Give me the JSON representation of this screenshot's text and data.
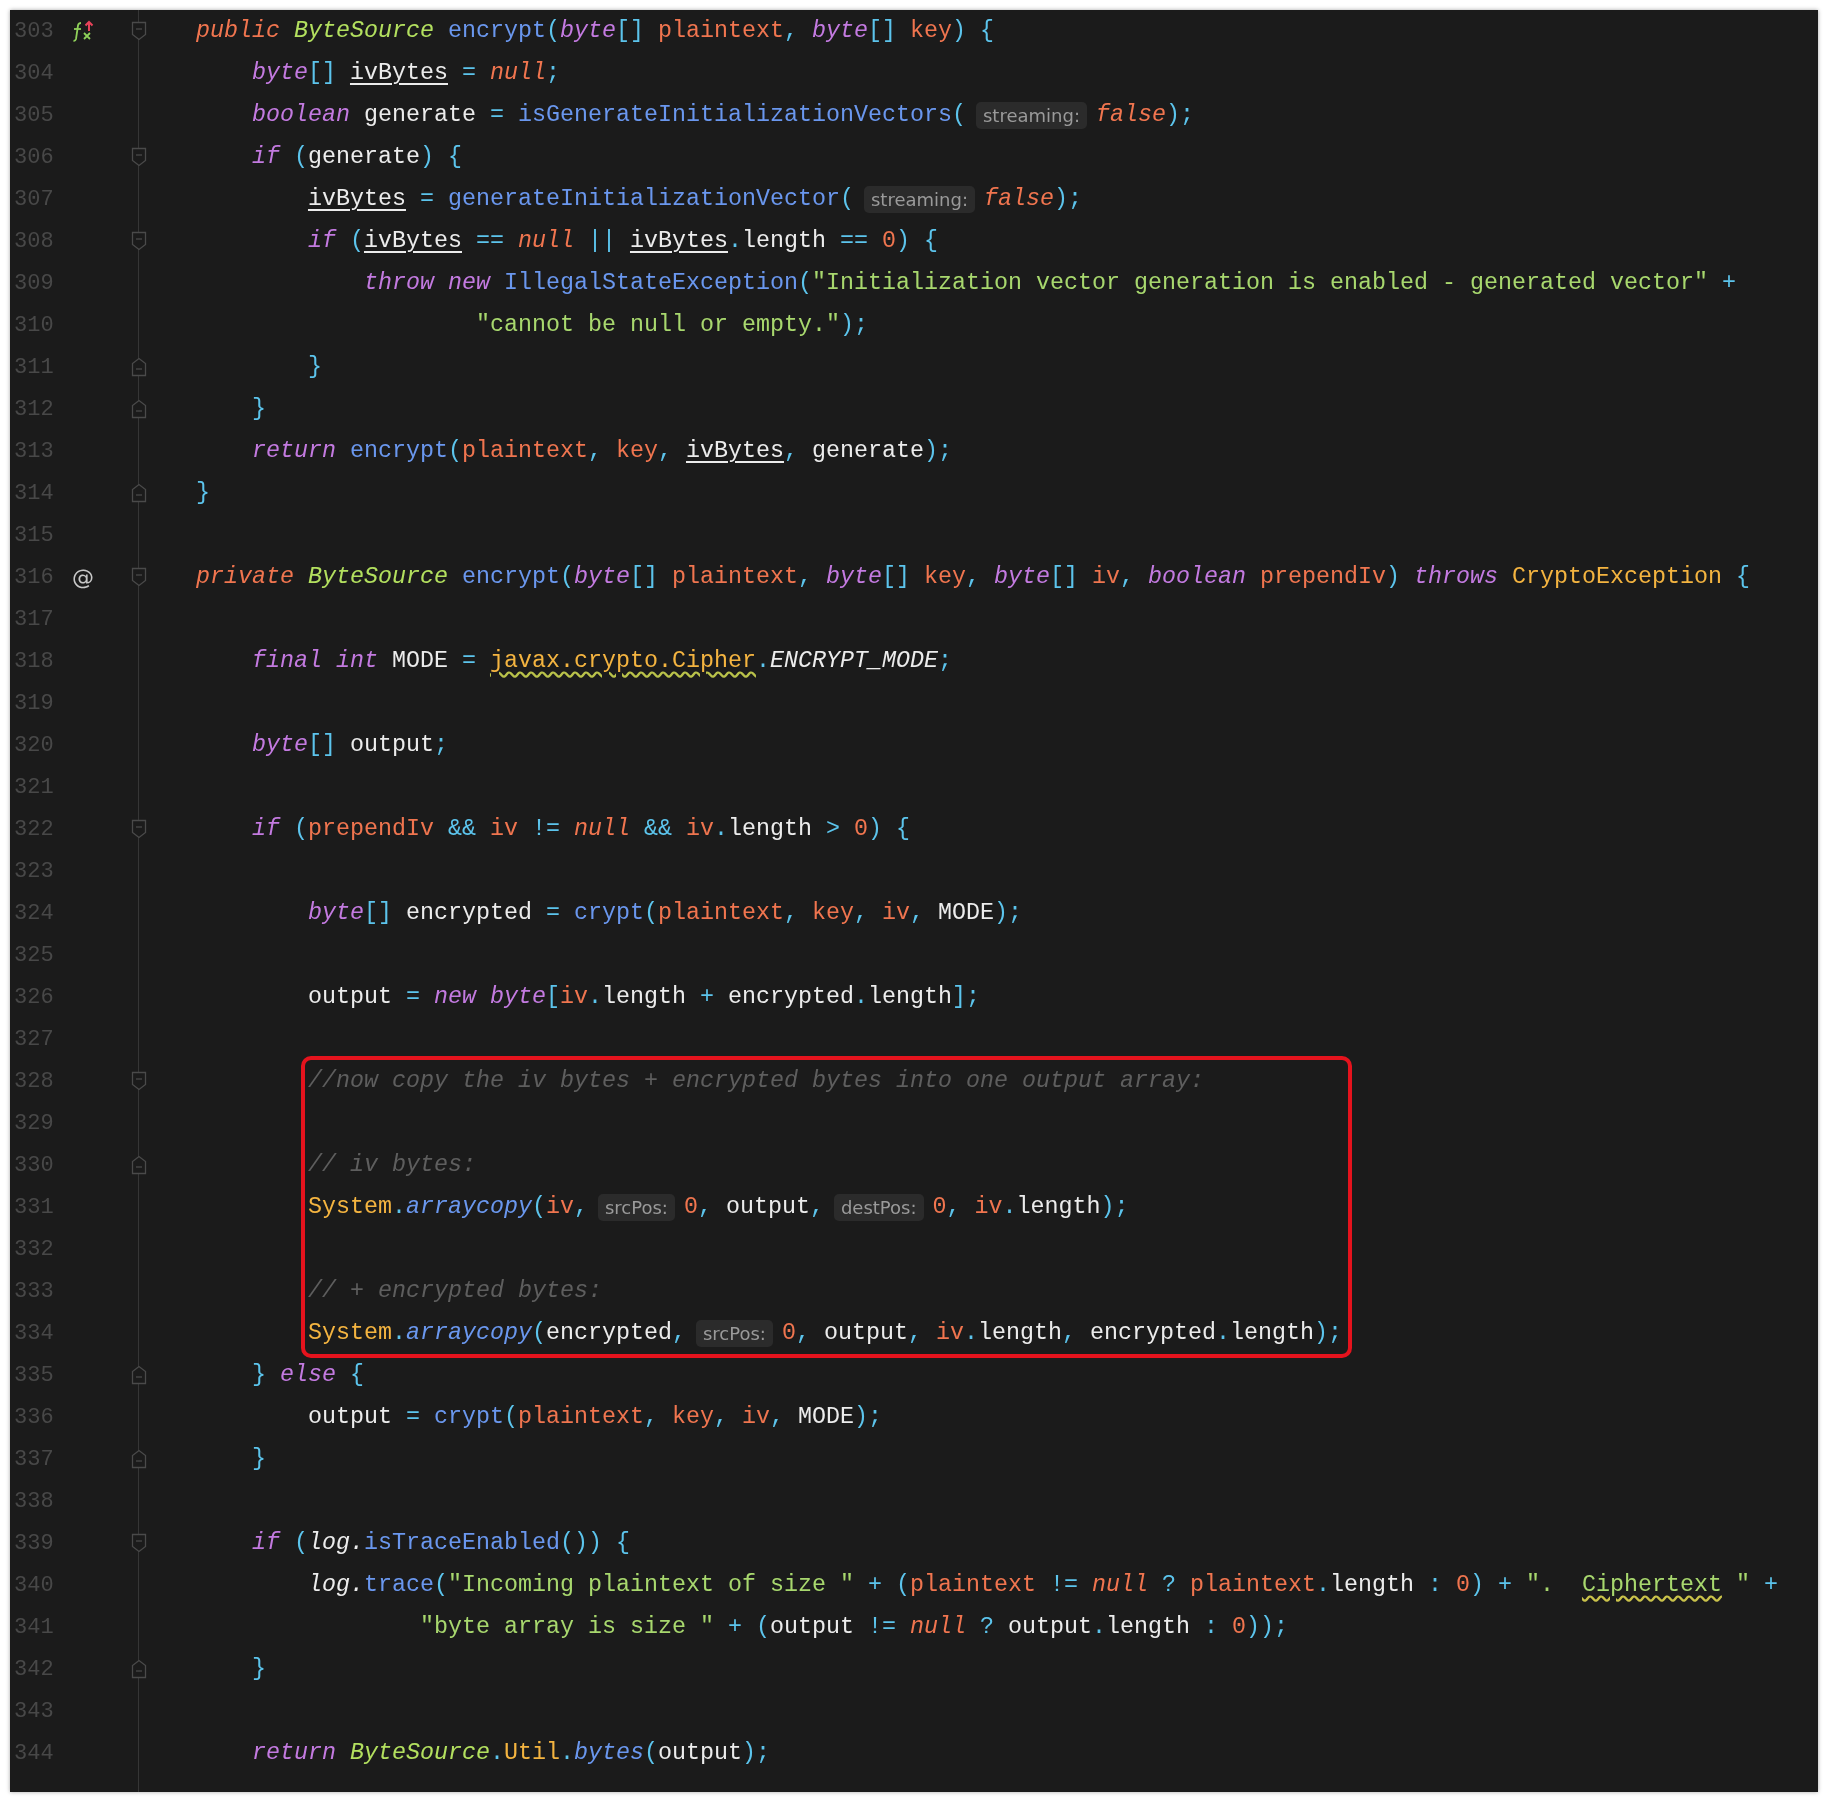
{
  "editor": {
    "lines": [
      {
        "number": "303",
        "gutter_icon": {
          "kind": "override"
        },
        "fold": {
          "kind": "start"
        },
        "highlighted": false,
        "code": [
          {
            "kind": "mod",
            "text": "public "
          },
          {
            "kind": "type",
            "text": "ByteSource "
          },
          {
            "kind": "fn",
            "text": "encrypt"
          },
          {
            "kind": "op",
            "text": "("
          },
          {
            "kind": "kw",
            "text": "byte"
          },
          {
            "kind": "op",
            "text": "[] "
          },
          {
            "kind": "param",
            "text": "plaintext"
          },
          {
            "kind": "op",
            "text": ", "
          },
          {
            "kind": "kw",
            "text": "byte"
          },
          {
            "kind": "op",
            "text": "[] "
          },
          {
            "kind": "param",
            "text": "key"
          },
          {
            "kind": "op",
            "text": ") {"
          }
        ]
      },
      {
        "number": "304",
        "highlighted": false,
        "code": [
          {
            "kind": "kw",
            "text": "    byte"
          },
          {
            "kind": "op",
            "text": "[] "
          },
          {
            "kind": "ul",
            "text": "ivBytes"
          },
          {
            "kind": "op",
            "text": " = "
          },
          {
            "kind": "mod",
            "text": "null"
          },
          {
            "kind": "op",
            "text": ";"
          }
        ]
      },
      {
        "number": "305",
        "highlighted": false,
        "code": [
          {
            "kind": "kw",
            "text": "    boolean "
          },
          {
            "kind": "id",
            "text": "generate "
          },
          {
            "kind": "op",
            "text": "= "
          },
          {
            "kind": "fn",
            "text": "isGenerateInitializationVectors"
          },
          {
            "kind": "op",
            "text": "("
          },
          {
            "kind": "hint",
            "text": "streaming:"
          },
          {
            "kind": "mod",
            "text": "false"
          },
          {
            "kind": "op",
            "text": ");"
          }
        ]
      },
      {
        "number": "306",
        "fold": {
          "kind": "start"
        },
        "highlighted": false,
        "code": [
          {
            "kind": "kw",
            "text": "    if "
          },
          {
            "kind": "op",
            "text": "("
          },
          {
            "kind": "id",
            "text": "generate"
          },
          {
            "kind": "op",
            "text": ") {"
          }
        ]
      },
      {
        "number": "307",
        "highlighted": false,
        "code": [
          {
            "kind": "ul",
            "text": "        ivBytes"
          },
          {
            "kind": "op",
            "text": " = "
          },
          {
            "kind": "fn",
            "text": "generateInitializationVector"
          },
          {
            "kind": "op",
            "text": "("
          },
          {
            "kind": "hint",
            "text": "streaming:"
          },
          {
            "kind": "mod",
            "text": "false"
          },
          {
            "kind": "op",
            "text": ");"
          }
        ]
      },
      {
        "number": "308",
        "fold": {
          "kind": "start"
        },
        "highlighted": false,
        "code": [
          {
            "kind": "kw",
            "text": "        if "
          },
          {
            "kind": "op",
            "text": "("
          },
          {
            "kind": "ul",
            "text": "ivBytes"
          },
          {
            "kind": "op",
            "text": " == "
          },
          {
            "kind": "mod",
            "text": "null"
          },
          {
            "kind": "op",
            "text": " || "
          },
          {
            "kind": "ul",
            "text": "ivBytes"
          },
          {
            "kind": "op",
            "text": "."
          },
          {
            "kind": "id",
            "text": "length"
          },
          {
            "kind": "op",
            "text": " == "
          },
          {
            "kind": "num",
            "text": "0"
          },
          {
            "kind": "op",
            "text": ") {"
          }
        ]
      },
      {
        "number": "309",
        "highlighted": false,
        "code": [
          {
            "kind": "kw",
            "text": "            throw new "
          },
          {
            "kind": "fn",
            "text": "IllegalStateException"
          },
          {
            "kind": "op",
            "text": "("
          },
          {
            "kind": "str",
            "text": "\"Initialization vector generation is enabled - generated vector\""
          },
          {
            "kind": "op",
            "text": " +"
          }
        ]
      },
      {
        "number": "310",
        "highlighted": false,
        "code": [
          {
            "kind": "str",
            "text": "                    \"cannot be null or empty.\""
          },
          {
            "kind": "op",
            "text": ");"
          }
        ]
      },
      {
        "number": "311",
        "fold": {
          "kind": "end"
        },
        "highlighted": false,
        "code": [
          {
            "kind": "op",
            "text": "        }"
          }
        ]
      },
      {
        "number": "312",
        "fold": {
          "kind": "end"
        },
        "highlighted": false,
        "code": [
          {
            "kind": "op",
            "text": "    }"
          }
        ]
      },
      {
        "number": "313",
        "highlighted": false,
        "code": [
          {
            "kind": "kw",
            "text": "    return "
          },
          {
            "kind": "fn",
            "text": "encrypt"
          },
          {
            "kind": "op",
            "text": "("
          },
          {
            "kind": "param",
            "text": "plaintext"
          },
          {
            "kind": "op",
            "text": ", "
          },
          {
            "kind": "param",
            "text": "key"
          },
          {
            "kind": "op",
            "text": ", "
          },
          {
            "kind": "ul",
            "text": "ivBytes"
          },
          {
            "kind": "op",
            "text": ", "
          },
          {
            "kind": "id",
            "text": "generate"
          },
          {
            "kind": "op",
            "text": ");"
          }
        ]
      },
      {
        "number": "314",
        "fold": {
          "kind": "end"
        },
        "highlighted": false,
        "code": [
          {
            "kind": "op",
            "text": "}"
          }
        ]
      },
      {
        "number": "315",
        "highlighted": false
      },
      {
        "number": "316",
        "gutter_text": "@",
        "fold": {
          "kind": "start"
        },
        "highlighted": false,
        "code": [
          {
            "kind": "mod",
            "text": "private "
          },
          {
            "kind": "type",
            "text": "ByteSource "
          },
          {
            "kind": "fn",
            "text": "encrypt"
          },
          {
            "kind": "op",
            "text": "("
          },
          {
            "kind": "kw",
            "text": "byte"
          },
          {
            "kind": "op",
            "text": "[] "
          },
          {
            "kind": "param",
            "text": "plaintext"
          },
          {
            "kind": "op",
            "text": ", "
          },
          {
            "kind": "kw",
            "text": "byte"
          },
          {
            "kind": "op",
            "text": "[] "
          },
          {
            "kind": "param",
            "text": "key"
          },
          {
            "kind": "op",
            "text": ", "
          },
          {
            "kind": "kw",
            "text": "byte"
          },
          {
            "kind": "op",
            "text": "[] "
          },
          {
            "kind": "param",
            "text": "iv"
          },
          {
            "kind": "op",
            "text": ", "
          },
          {
            "kind": "kw",
            "text": "boolean "
          },
          {
            "kind": "param",
            "text": "prependIv"
          },
          {
            "kind": "op",
            "text": ") "
          },
          {
            "kind": "kw",
            "text": "throws "
          },
          {
            "kind": "cls",
            "text": "CryptoException "
          },
          {
            "kind": "op",
            "text": "{"
          }
        ]
      },
      {
        "number": "317",
        "highlighted": false
      },
      {
        "number": "318",
        "highlighted": false,
        "code": [
          {
            "kind": "kw",
            "text": "    final int "
          },
          {
            "kind": "id",
            "text": "MODE "
          },
          {
            "kind": "op",
            "text": "= "
          },
          {
            "kind": "clsw",
            "text": "javax.crypto.Cipher"
          },
          {
            "kind": "op",
            "text": "."
          },
          {
            "kind": "const",
            "text": "ENCRYPT_MODE"
          },
          {
            "kind": "op",
            "text": ";"
          }
        ]
      },
      {
        "number": "319",
        "highlighted": false
      },
      {
        "number": "320",
        "highlighted": false,
        "code": [
          {
            "kind": "kw",
            "text": "    byte"
          },
          {
            "kind": "op",
            "text": "[] "
          },
          {
            "kind": "id",
            "text": "output"
          },
          {
            "kind": "op",
            "text": ";"
          }
        ]
      },
      {
        "number": "321",
        "highlighted": false
      },
      {
        "number": "322",
        "fold": {
          "kind": "start"
        },
        "highlighted": false,
        "code": [
          {
            "kind": "kw",
            "text": "    if "
          },
          {
            "kind": "op",
            "text": "("
          },
          {
            "kind": "param",
            "text": "prependIv"
          },
          {
            "kind": "op",
            "text": " && "
          },
          {
            "kind": "param",
            "text": "iv"
          },
          {
            "kind": "op",
            "text": " != "
          },
          {
            "kind": "mod",
            "text": "null"
          },
          {
            "kind": "op",
            "text": " && "
          },
          {
            "kind": "param",
            "text": "iv"
          },
          {
            "kind": "op",
            "text": "."
          },
          {
            "kind": "id",
            "text": "length"
          },
          {
            "kind": "op",
            "text": " > "
          },
          {
            "kind": "num",
            "text": "0"
          },
          {
            "kind": "op",
            "text": ") {"
          }
        ]
      },
      {
        "number": "323",
        "highlighted": false
      },
      {
        "number": "324",
        "highlighted": false,
        "code": [
          {
            "kind": "kw",
            "text": "        byte"
          },
          {
            "kind": "op",
            "text": "[] "
          },
          {
            "kind": "id",
            "text": "encrypted "
          },
          {
            "kind": "op",
            "text": "= "
          },
          {
            "kind": "fn",
            "text": "crypt"
          },
          {
            "kind": "op",
            "text": "("
          },
          {
            "kind": "param",
            "text": "plaintext"
          },
          {
            "kind": "op",
            "text": ", "
          },
          {
            "kind": "param",
            "text": "key"
          },
          {
            "kind": "op",
            "text": ", "
          },
          {
            "kind": "param",
            "text": "iv"
          },
          {
            "kind": "op",
            "text": ", "
          },
          {
            "kind": "id",
            "text": "MODE"
          },
          {
            "kind": "op",
            "text": ");"
          }
        ]
      },
      {
        "number": "325",
        "highlighted": false
      },
      {
        "number": "326",
        "highlighted": false,
        "code": [
          {
            "kind": "id",
            "text": "        output "
          },
          {
            "kind": "op",
            "text": "= "
          },
          {
            "kind": "kw",
            "text": "new byte"
          },
          {
            "kind": "op",
            "text": "["
          },
          {
            "kind": "param",
            "text": "iv"
          },
          {
            "kind": "op",
            "text": "."
          },
          {
            "kind": "id",
            "text": "length "
          },
          {
            "kind": "op",
            "text": "+ "
          },
          {
            "kind": "id",
            "text": "encrypted"
          },
          {
            "kind": "op",
            "text": "."
          },
          {
            "kind": "id",
            "text": "length"
          },
          {
            "kind": "op",
            "text": "];"
          }
        ]
      },
      {
        "number": "327",
        "highlighted": false
      },
      {
        "number": "328",
        "fold": {
          "kind": "start"
        },
        "highlighted": true,
        "code": [
          {
            "kind": "cmt",
            "text": "        //now copy the iv bytes + encrypted bytes into one output array:"
          }
        ]
      },
      {
        "number": "329",
        "highlighted": true
      },
      {
        "number": "330",
        "fold": {
          "kind": "end"
        },
        "highlighted": true,
        "code": [
          {
            "kind": "cmt",
            "text": "        // iv bytes:"
          }
        ]
      },
      {
        "number": "331",
        "highlighted": true,
        "code": [
          {
            "kind": "cls",
            "text": "        System"
          },
          {
            "kind": "op",
            "text": "."
          },
          {
            "kind": "fni",
            "text": "arraycopy"
          },
          {
            "kind": "op",
            "text": "("
          },
          {
            "kind": "param",
            "text": "iv"
          },
          {
            "kind": "op",
            "text": ","
          },
          {
            "kind": "hint",
            "text": "srcPos:"
          },
          {
            "kind": "num",
            "text": "0"
          },
          {
            "kind": "op",
            "text": ", "
          },
          {
            "kind": "id",
            "text": "output"
          },
          {
            "kind": "op",
            "text": ","
          },
          {
            "kind": "hint",
            "text": "destPos:"
          },
          {
            "kind": "num",
            "text": "0"
          },
          {
            "kind": "op",
            "text": ", "
          },
          {
            "kind": "param",
            "text": "iv"
          },
          {
            "kind": "op",
            "text": "."
          },
          {
            "kind": "id",
            "text": "length"
          },
          {
            "kind": "op",
            "text": ");"
          }
        ]
      },
      {
        "number": "332",
        "highlighted": true
      },
      {
        "number": "333",
        "highlighted": true,
        "code": [
          {
            "kind": "cmt",
            "text": "        // + encrypted bytes:"
          }
        ]
      },
      {
        "number": "334",
        "highlighted": true,
        "code": [
          {
            "kind": "cls",
            "text": "        System"
          },
          {
            "kind": "op",
            "text": "."
          },
          {
            "kind": "fni",
            "text": "arraycopy"
          },
          {
            "kind": "op",
            "text": "("
          },
          {
            "kind": "id",
            "text": "encrypted"
          },
          {
            "kind": "op",
            "text": ","
          },
          {
            "kind": "hint",
            "text": "srcPos:"
          },
          {
            "kind": "num",
            "text": "0"
          },
          {
            "kind": "op",
            "text": ", "
          },
          {
            "kind": "id",
            "text": "output"
          },
          {
            "kind": "op",
            "text": ", "
          },
          {
            "kind": "param",
            "text": "iv"
          },
          {
            "kind": "op",
            "text": "."
          },
          {
            "kind": "id",
            "text": "length"
          },
          {
            "kind": "op",
            "text": ", "
          },
          {
            "kind": "id",
            "text": "encrypted"
          },
          {
            "kind": "op",
            "text": "."
          },
          {
            "kind": "id",
            "text": "length"
          },
          {
            "kind": "op",
            "text": ");"
          }
        ]
      },
      {
        "number": "335",
        "fold": {
          "kind": "end"
        },
        "highlighted": false,
        "code": [
          {
            "kind": "op",
            "text": "    } "
          },
          {
            "kind": "kw",
            "text": "else "
          },
          {
            "kind": "op",
            "text": "{"
          }
        ]
      },
      {
        "number": "336",
        "highlighted": false,
        "code": [
          {
            "kind": "id",
            "text": "        output "
          },
          {
            "kind": "op",
            "text": "= "
          },
          {
            "kind": "fn",
            "text": "crypt"
          },
          {
            "kind": "op",
            "text": "("
          },
          {
            "kind": "param",
            "text": "plaintext"
          },
          {
            "kind": "op",
            "text": ", "
          },
          {
            "kind": "param",
            "text": "key"
          },
          {
            "kind": "op",
            "text": ", "
          },
          {
            "kind": "param",
            "text": "iv"
          },
          {
            "kind": "op",
            "text": ", "
          },
          {
            "kind": "id",
            "text": "MODE"
          },
          {
            "kind": "op",
            "text": ");"
          }
        ]
      },
      {
        "number": "337",
        "fold": {
          "kind": "end"
        },
        "highlighted": false,
        "code": [
          {
            "kind": "op",
            "text": "    }"
          }
        ]
      },
      {
        "number": "338",
        "highlighted": false
      },
      {
        "number": "339",
        "fold": {
          "kind": "start"
        },
        "highlighted": false,
        "code": [
          {
            "kind": "kw",
            "text": "    if "
          },
          {
            "kind": "op",
            "text": "("
          },
          {
            "kind": "const",
            "text": "log."
          },
          {
            "kind": "fn",
            "text": "isTraceEnabled"
          },
          {
            "kind": "op",
            "text": "()) {"
          }
        ]
      },
      {
        "number": "340",
        "highlighted": false,
        "code": [
          {
            "kind": "const",
            "text": "        log."
          },
          {
            "kind": "fn",
            "text": "trace"
          },
          {
            "kind": "op",
            "text": "("
          },
          {
            "kind": "str",
            "text": "\"Incoming plaintext of size \""
          },
          {
            "kind": "op",
            "text": " + ("
          },
          {
            "kind": "param",
            "text": "plaintext"
          },
          {
            "kind": "op",
            "text": " != "
          },
          {
            "kind": "mod",
            "text": "null"
          },
          {
            "kind": "op",
            "text": " ? "
          },
          {
            "kind": "param",
            "text": "plaintext"
          },
          {
            "kind": "op",
            "text": "."
          },
          {
            "kind": "id",
            "text": "length"
          },
          {
            "kind": "op",
            "text": " : "
          },
          {
            "kind": "num",
            "text": "0"
          },
          {
            "kind": "op",
            "text": ") + "
          },
          {
            "kind": "str",
            "text": "\".  "
          },
          {
            "kind": "strw",
            "text": "Ciphertext"
          },
          {
            "kind": "str",
            "text": " \""
          },
          {
            "kind": "op",
            "text": " +"
          }
        ]
      },
      {
        "number": "341",
        "highlighted": false,
        "code": [
          {
            "kind": "str",
            "text": "                \"byte array is size \""
          },
          {
            "kind": "op",
            "text": " + ("
          },
          {
            "kind": "id",
            "text": "output"
          },
          {
            "kind": "op",
            "text": " != "
          },
          {
            "kind": "mod",
            "text": "null"
          },
          {
            "kind": "op",
            "text": " ? "
          },
          {
            "kind": "id",
            "text": "output"
          },
          {
            "kind": "op",
            "text": "."
          },
          {
            "kind": "id",
            "text": "length"
          },
          {
            "kind": "op",
            "text": " : "
          },
          {
            "kind": "num",
            "text": "0"
          },
          {
            "kind": "op",
            "text": "));"
          }
        ]
      },
      {
        "number": "342",
        "fold": {
          "kind": "end"
        },
        "highlighted": false,
        "code": [
          {
            "kind": "op",
            "text": "    }"
          }
        ]
      },
      {
        "number": "343",
        "highlighted": false
      },
      {
        "number": "344",
        "highlighted": false,
        "code": [
          {
            "kind": "kw",
            "text": "    return "
          },
          {
            "kind": "type",
            "text": "ByteSource"
          },
          {
            "kind": "op",
            "text": "."
          },
          {
            "kind": "cls",
            "text": "Util"
          },
          {
            "kind": "op",
            "text": "."
          },
          {
            "kind": "fni",
            "text": "bytes"
          },
          {
            "kind": "op",
            "text": "("
          },
          {
            "kind": "id",
            "text": "output"
          },
          {
            "kind": "op",
            "text": ");"
          }
        ]
      }
    ]
  }
}
